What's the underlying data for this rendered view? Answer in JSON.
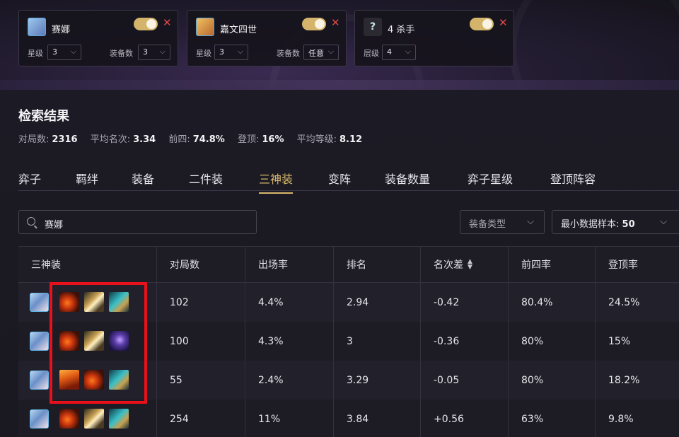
{
  "filters": [
    {
      "name": "赛娜",
      "icon": "champion-icon",
      "fields": [
        {
          "label": "星级",
          "value": "3"
        },
        {
          "label": "装备数",
          "value": "3"
        }
      ]
    },
    {
      "name": "嘉文四世",
      "icon": "champion-icon",
      "fields": [
        {
          "label": "星级",
          "value": "3"
        },
        {
          "label": "装备数",
          "value": "任意"
        }
      ]
    },
    {
      "name": "4 杀手",
      "icon": "trait-icon",
      "fields": [
        {
          "label": "层级",
          "value": "4"
        }
      ]
    }
  ],
  "results": {
    "title": "检索结果",
    "stats": [
      {
        "label": "对局数:",
        "value": "2316"
      },
      {
        "label": "平均名次:",
        "value": "3.34"
      },
      {
        "label": "前四:",
        "value": "74.8%"
      },
      {
        "label": "登顶:",
        "value": "16%"
      },
      {
        "label": "平均等级:",
        "value": "8.12"
      }
    ]
  },
  "tabs": [
    "弈子",
    "羁绊",
    "装备",
    "二件装",
    "三神装",
    "变阵",
    "装备数量",
    "弈子星级",
    "登顶阵容"
  ],
  "active_tab": "三神装",
  "search": {
    "value": "赛娜"
  },
  "dropdowns": {
    "equip_type": "装备类型",
    "min_sample_label": "最小数据样本:",
    "min_sample_value": "50"
  },
  "table": {
    "headers": [
      "三神装",
      "对局数",
      "出场率",
      "排名",
      "名次差",
      "前四率",
      "登顶率"
    ],
    "rows": [
      {
        "items": [
          "item-a",
          "item-b",
          "item-c"
        ],
        "games": "102",
        "pick_rate": "4.4%",
        "rank": "2.94",
        "diff": "-0.42",
        "top4": "80.4%",
        "win": "24.5%"
      },
      {
        "items": [
          "item-a",
          "item-b",
          "item-d"
        ],
        "games": "100",
        "pick_rate": "4.3%",
        "rank": "3",
        "diff": "-0.36",
        "top4": "80%",
        "win": "15%"
      },
      {
        "items": [
          "item-e",
          "item-a",
          "item-c"
        ],
        "games": "55",
        "pick_rate": "2.4%",
        "rank": "3.29",
        "diff": "-0.05",
        "top4": "80%",
        "win": "18.2%"
      },
      {
        "items": [
          "item-a",
          "item-b",
          "item-c"
        ],
        "games": "254",
        "pick_rate": "11%",
        "rank": "3.84",
        "diff": "+0.56",
        "top4": "63%",
        "win": "9.8%"
      }
    ]
  },
  "colors": {
    "accent": "#d9b86c",
    "highlight": "#e8101a",
    "toggle": "#d4b36a"
  }
}
